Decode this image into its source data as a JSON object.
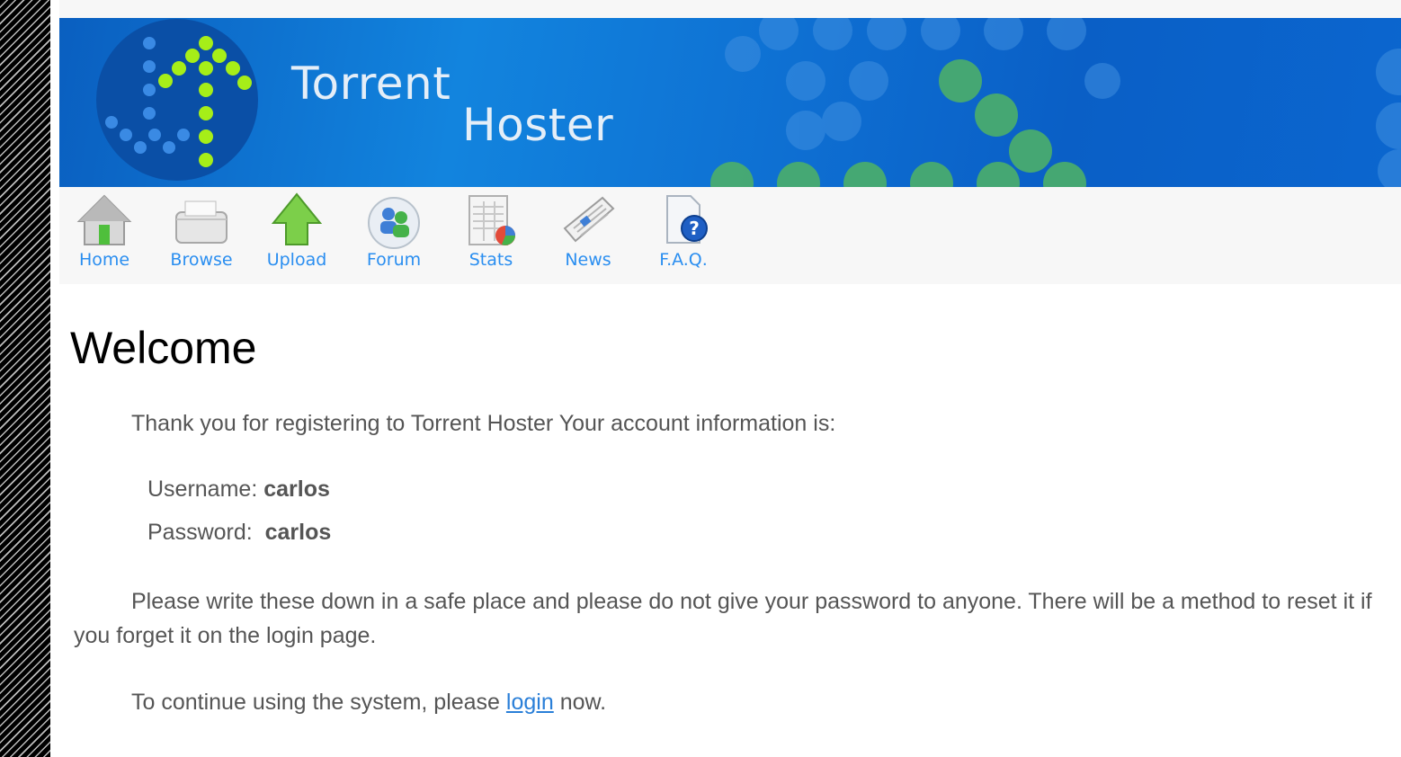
{
  "brand": {
    "line1": "Torrent",
    "line2": "Hoster"
  },
  "nav": [
    {
      "label": "Home",
      "icon": "home-icon"
    },
    {
      "label": "Browse",
      "icon": "browse-icon"
    },
    {
      "label": "Upload",
      "icon": "upload-icon"
    },
    {
      "label": "Forum",
      "icon": "forum-icon"
    },
    {
      "label": "Stats",
      "icon": "stats-icon"
    },
    {
      "label": "News",
      "icon": "news-icon"
    },
    {
      "label": "F.A.Q.",
      "icon": "faq-icon"
    }
  ],
  "main": {
    "title": "Welcome",
    "intro": "Thank you for registering to Torrent Hoster Your account information is:",
    "username_label": "Username:",
    "username_value": "carlos",
    "password_label": "Password:",
    "password_value": "carlos",
    "warning": "Please write these down in a safe place and please do not give your password to anyone. There will be a method to reset it if you forget it on the login page.",
    "continue_before": "To continue using the system, please ",
    "continue_link": "login",
    "continue_after": " now."
  },
  "colors": {
    "banner": "#0e6fd2",
    "link": "#2a8ef0",
    "text": "#555555"
  }
}
